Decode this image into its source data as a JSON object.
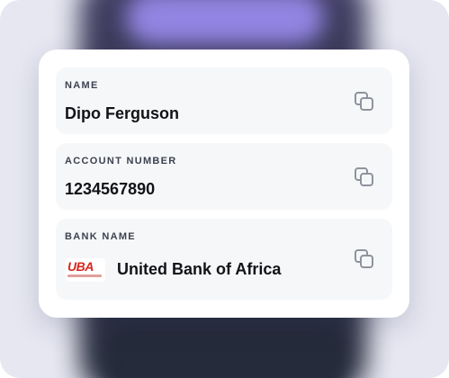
{
  "details": {
    "name": {
      "label": "NAME",
      "value": "Dipo Ferguson"
    },
    "account_number": {
      "label": "ACCOUNT NUMBER",
      "value": "1234567890"
    },
    "bank_name": {
      "label": "BANK NAME",
      "value": "United Bank of Africa",
      "logo_text": "UBA"
    }
  },
  "icons": {
    "copy": "copy-icon"
  },
  "colors": {
    "logo_red": "#d7261e",
    "field_bg": "#f6f7f9",
    "text_primary": "#111317",
    "label_text": "#3d4250"
  }
}
